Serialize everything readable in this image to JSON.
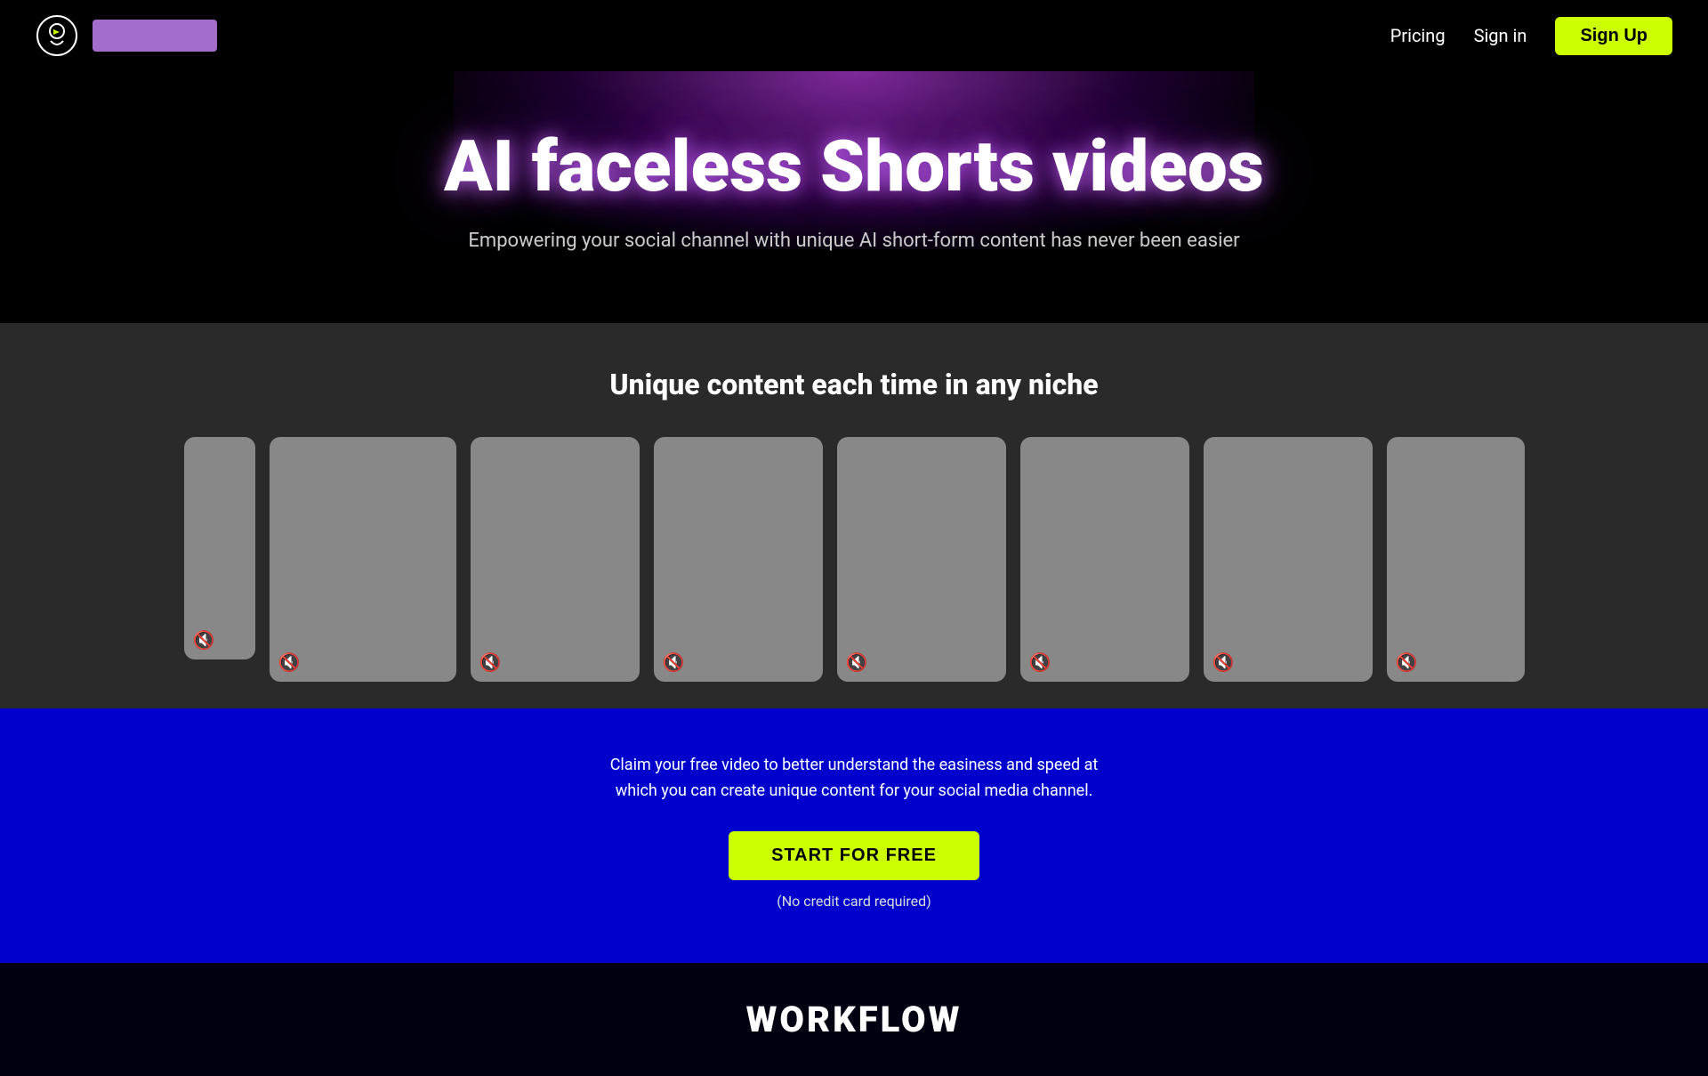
{
  "navbar": {
    "pricing_label": "Pricing",
    "signin_label": "Sign in",
    "signup_label": "Sign Up"
  },
  "hero": {
    "title": "AI faceless Shorts videos",
    "subtitle": "Empowering your social channel with unique AI short-form content has never been easier"
  },
  "content_section": {
    "title": "Unique content each time in any niche",
    "video_count": 8
  },
  "cta_section": {
    "description_line1": "Claim your free video to better understand the easiness and speed at",
    "description_line2": "which you can create unique content for your social media channel.",
    "button_label": "START FOR FREE",
    "note": "(No credit card required)"
  },
  "workflow_section": {
    "title": "WORKFLOW"
  },
  "icons": {
    "mute": "🔇",
    "logo": "💡"
  }
}
